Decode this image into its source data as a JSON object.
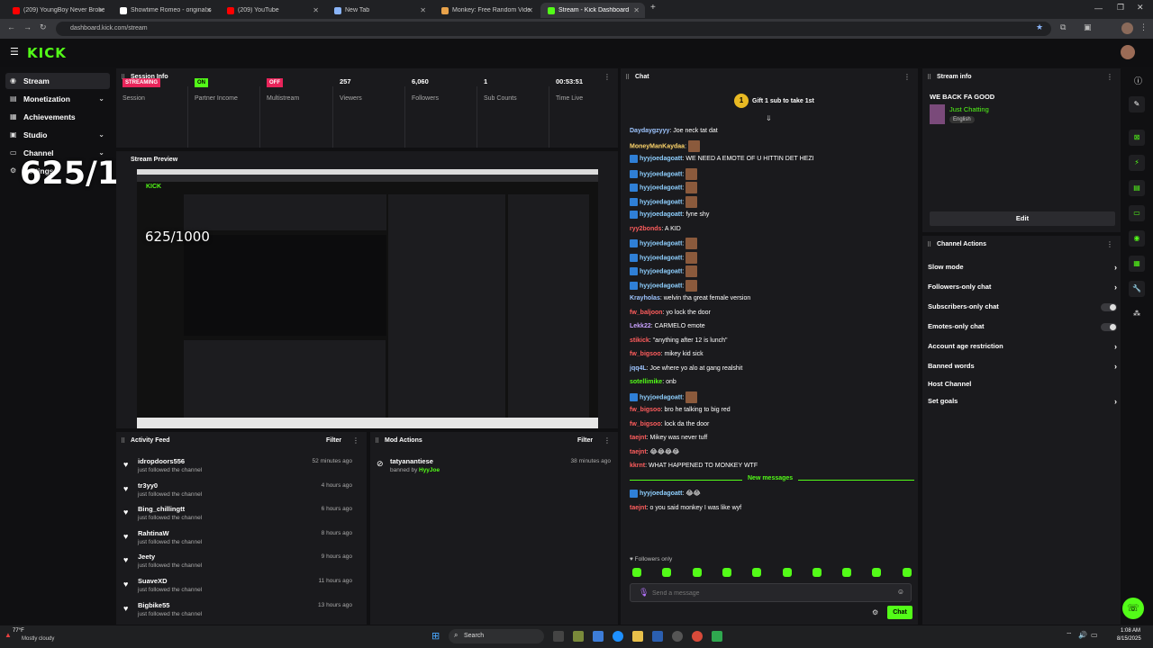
{
  "browser": {
    "tabs": [
      {
        "label": "(209) YoungBoy Never Broke A",
        "color": "#ff0000"
      },
      {
        "label": "Showtime Romeo - original so",
        "color": "#ffffff"
      },
      {
        "label": "(209) YouTube",
        "color": "#ff0000"
      },
      {
        "label": "New Tab",
        "color": "#8ab4f8"
      },
      {
        "label": "Monkey: Free Random Vide",
        "color": "#e8a24a"
      },
      {
        "label": "Stream - Kick Dashboard",
        "color": "#53fc18"
      }
    ],
    "url": "dashboard.kick.com/stream"
  },
  "brand": {
    "logo": "KICK",
    "accent": "#53fc18"
  },
  "sidebar": {
    "items": [
      {
        "label": "Stream",
        "icon": "broadcast-icon"
      },
      {
        "label": "Monetization",
        "icon": "money-icon"
      },
      {
        "label": "Achievements",
        "icon": "trophy-icon"
      },
      {
        "label": "Studio",
        "icon": "studio-icon"
      },
      {
        "label": "Channel",
        "icon": "channel-icon"
      },
      {
        "label": "Settings",
        "icon": "gear-icon"
      }
    ]
  },
  "overlay": {
    "counter": "625/1000",
    "counter_small": "625/1000"
  },
  "session": {
    "title": "Session Info",
    "stats": [
      {
        "value": "STREAMING",
        "label": "Session",
        "badge": "#e8245a"
      },
      {
        "value": "ON",
        "label": "Partner Income",
        "badge": "#53fc18"
      },
      {
        "value": "OFF",
        "label": "Multistream",
        "badge": "#e8245a"
      },
      {
        "value": "257",
        "label": "Viewers"
      },
      {
        "value": "6,060",
        "label": "Followers"
      },
      {
        "value": "1",
        "label": "Sub Counts"
      },
      {
        "value": "00:53:51",
        "label": "Time Live"
      }
    ]
  },
  "preview": {
    "title": "Stream Preview"
  },
  "activity": {
    "title": "Activity Feed",
    "filter": "Filter",
    "rows": [
      {
        "name": "idropdoors556",
        "sub": "just followed the channel",
        "time": "52 minutes ago"
      },
      {
        "name": "tr3yy0",
        "sub": "just followed the channel",
        "time": "4 hours ago"
      },
      {
        "name": "Bing_chillingtt",
        "sub": "just followed the channel",
        "time": "6 hours ago"
      },
      {
        "name": "RahtinaW",
        "sub": "just followed the channel",
        "time": "8 hours ago"
      },
      {
        "name": "Jeety",
        "sub": "just followed the channel",
        "time": "9 hours ago"
      },
      {
        "name": "SuaveXD",
        "sub": "just followed the channel",
        "time": "11 hours ago"
      },
      {
        "name": "Bigbike55",
        "sub": "just followed the channel",
        "time": "13 hours ago"
      }
    ]
  },
  "mod": {
    "title": "Mod Actions",
    "filter": "Filter",
    "row": {
      "name": "tatyanantiese",
      "sub_prefix": "banned by",
      "by": "HyyJoe",
      "time": "38 minutes ago"
    }
  },
  "chat": {
    "title": "Chat",
    "gift": "Gift 1 sub to take 1st",
    "messages": [
      {
        "user": "Daydaygzyyy",
        "color": "#9ec5ff",
        "text": ": Joe neck tat dat",
        "mod": false,
        "emotes": 0
      },
      {
        "user": "MoneyManKaydaa",
        "color": "#ffd66b",
        "text": ":",
        "mod": false,
        "emotes": 1
      },
      {
        "user": "hyyjoedagoatt",
        "color": "#8fd0ff",
        "text": ": WE NEED A EMOTE OF U HITTIN DET HEZI",
        "mod": true,
        "emotes": 0
      },
      {
        "user": "hyyjoedagoatt",
        "color": "#8fd0ff",
        "text": ":",
        "mod": true,
        "emotes": 1
      },
      {
        "user": "hyyjoedagoatt",
        "color": "#8fd0ff",
        "text": ":",
        "mod": true,
        "emotes": 1
      },
      {
        "user": "hyyjoedagoatt",
        "color": "#8fd0ff",
        "text": ":",
        "mod": true,
        "emotes": 1
      },
      {
        "user": "hyyjoedagoatt",
        "color": "#8fd0ff",
        "text": ": fyne shy",
        "mod": true,
        "emotes": 0
      },
      {
        "user": "ryy2bonds",
        "color": "#ff5d5d",
        "text": ": A KID",
        "mod": false,
        "emotes": 0
      },
      {
        "user": "hyyjoedagoatt",
        "color": "#8fd0ff",
        "text": ":",
        "mod": true,
        "emotes": 1
      },
      {
        "user": "hyyjoedagoatt",
        "color": "#8fd0ff",
        "text": ":",
        "mod": true,
        "emotes": 1
      },
      {
        "user": "hyyjoedagoatt",
        "color": "#8fd0ff",
        "text": ":",
        "mod": true,
        "emotes": 1
      },
      {
        "user": "hyyjoedagoatt",
        "color": "#8fd0ff",
        "text": ":",
        "mod": true,
        "emotes": 1
      },
      {
        "user": "Krayholas",
        "color": "#9ec5ff",
        "text": ": welvin tha great female version",
        "mod": false,
        "emotes": 0
      },
      {
        "user": "fw_baljoon",
        "color": "#ff5d5d",
        "text": ": yo lock the door",
        "mod": false,
        "emotes": 0
      },
      {
        "user": "Lekk22",
        "color": "#c9a2ff",
        "text": ": CARMELO emote",
        "mod": false,
        "emotes": 0
      },
      {
        "user": "stikick",
        "color": "#ff5d5d",
        "text": ": \"anything after 12 is lunch\"",
        "mod": false,
        "emotes": 0
      },
      {
        "user": "fw_bigsoo",
        "color": "#ff5d5d",
        "text": ": mikey kid sick",
        "mod": false,
        "emotes": 0
      },
      {
        "user": "jqq4L",
        "color": "#9ec5ff",
        "text": ": Joe where yo alo at gang realshit",
        "mod": false,
        "emotes": 0
      },
      {
        "user": "sotellimike",
        "color": "#53fc18",
        "text": ": onb",
        "mod": false,
        "emotes": 0
      },
      {
        "user": "hyyjoedagoatt",
        "color": "#8fd0ff",
        "text": ":",
        "mod": true,
        "emotes": 1
      },
      {
        "user": "fw_bigsoo",
        "color": "#ff5d5d",
        "text": ": bro he talking to big red",
        "mod": false,
        "emotes": 0
      },
      {
        "user": "fw_bigsoo",
        "color": "#ff5d5d",
        "text": ": lock da the door",
        "mod": false,
        "emotes": 0
      },
      {
        "user": "taejnt",
        "color": "#ff5d5d",
        "text": ": Mikey was never tuff",
        "mod": false,
        "emotes": 0
      },
      {
        "user": "taejnt",
        "color": "#ff5d5d",
        "text": ": 😂😂😂😂",
        "mod": false,
        "emotes": 0
      },
      {
        "user": "kkrnt",
        "color": "#ff5d5d",
        "text": ": WHAT HAPPENED TO MONKEY WTF",
        "mod": false,
        "emotes": 0
      }
    ],
    "new_messages": "New messages",
    "after": [
      {
        "user": "hyyjoedagoatt",
        "color": "#8fd0ff",
        "text": ": 😂😂",
        "mod": true
      },
      {
        "user": "taejnt",
        "color": "#ff5d5d",
        "text": ": o you said monkey I was like wyf",
        "mod": false
      }
    ],
    "followers_only": "Followers only",
    "placeholder": "Send a message",
    "send": "Chat"
  },
  "stream_info": {
    "title": "Stream info",
    "stream_title": "WE BACK FA GOOD",
    "category": "Just Chatting",
    "language": "English",
    "edit": "Edit"
  },
  "channel_actions": {
    "title": "Channel Actions",
    "items": [
      {
        "label": "Slow mode",
        "kind": "chevron"
      },
      {
        "label": "Followers-only chat",
        "kind": "chevron"
      },
      {
        "label": "Subscribers-only chat",
        "kind": "toggle"
      },
      {
        "label": "Emotes-only chat",
        "kind": "toggle"
      },
      {
        "label": "Account age restriction",
        "kind": "chevron"
      },
      {
        "label": "Banned words",
        "kind": "chevron"
      },
      {
        "label": "Host Channel",
        "kind": "none"
      },
      {
        "label": "Set goals",
        "kind": "chevron"
      }
    ]
  },
  "taskbar": {
    "weather_temp": "77°F",
    "weather": "Mostly cloudy",
    "search": "Search",
    "time": "1:08 AM",
    "date": "8/15/2025"
  }
}
